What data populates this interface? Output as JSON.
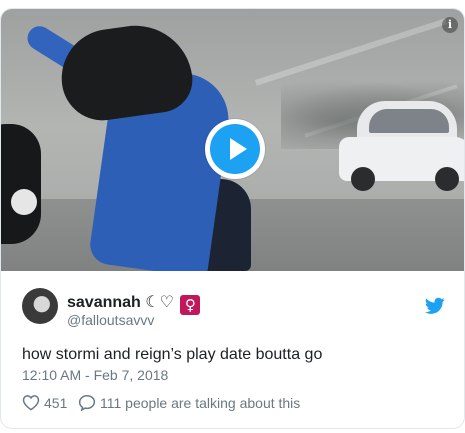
{
  "tweet": {
    "display_name": "savannah",
    "name_emoji": "☾♡",
    "name_badge": "♀",
    "handle": "@falloutsavvv",
    "text": "how stormi and reign’s play date boutta go",
    "timestamp": "12:10 AM - Feb 7, 2018",
    "likes": "451",
    "talking": "111 people are talking about this"
  },
  "icons": {
    "info": "info-icon",
    "play": "play-icon",
    "twitter": "twitter-bird-icon",
    "heart": "heart-icon",
    "reply": "reply-bubble-icon"
  },
  "colors": {
    "accent": "#1da1f2",
    "text": "#1c2022",
    "muted": "#697882",
    "border": "#e1e8ed",
    "badge": "#c2185b"
  }
}
